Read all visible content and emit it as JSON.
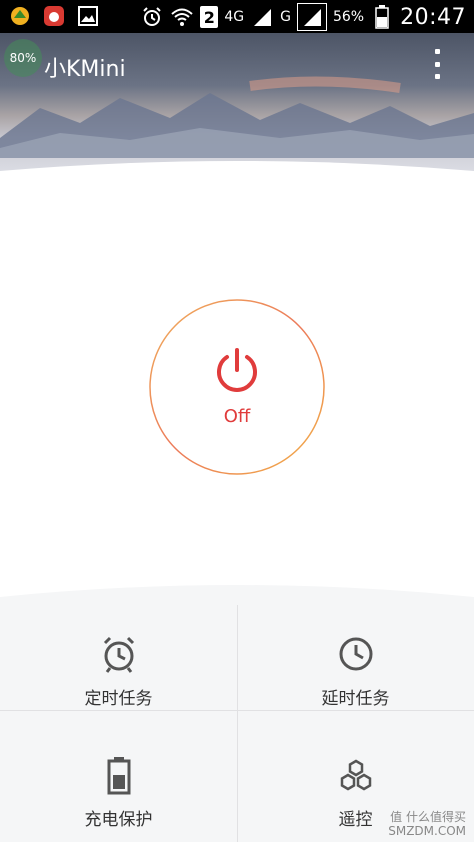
{
  "status_bar": {
    "sim_label": "2",
    "network_type": "4G",
    "network_type_2": "G",
    "battery_percent": "56%",
    "time": "20:47"
  },
  "header": {
    "app_title": "小KMini",
    "badge_text": "80%"
  },
  "power": {
    "state_label": "Off",
    "accent_color": "#e03c3c"
  },
  "features": [
    {
      "label": "定时任务",
      "icon": "alarm-clock-icon"
    },
    {
      "label": "延时任务",
      "icon": "clock-icon"
    },
    {
      "label": "充电保护",
      "icon": "battery-icon"
    },
    {
      "label": "遥控",
      "icon": "honeycomb-icon"
    }
  ],
  "watermark": {
    "line1": "值 什么值得买",
    "line2": "SMZDM.COM"
  }
}
